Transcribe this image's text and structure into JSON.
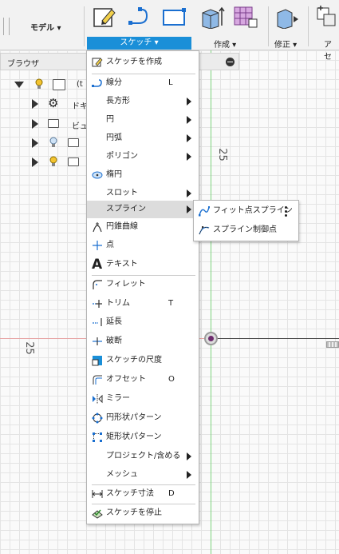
{
  "toolbar": {
    "model_label": "モデル ▾",
    "sketch_tab_label": "スケッチ ▾",
    "create_label": "作成 ▾",
    "modify_label": "修正 ▾",
    "assemble_label": "アセ"
  },
  "browser": {
    "title": "ブラウザ",
    "rows": [
      {
        "label": "(t"
      },
      {
        "label": "ドキ"
      },
      {
        "label": "ビュ"
      }
    ]
  },
  "canvas": {
    "ruler_top": "25",
    "ruler_left": "25"
  },
  "menu": {
    "items": [
      {
        "label": "スケッチを作成",
        "icon": "create-sketch-icon"
      },
      {
        "label": "線分",
        "shortcut": "L",
        "icon": "line-icon"
      },
      {
        "label": "長方形",
        "icon": "none"
      },
      {
        "label": "円",
        "icon": "none"
      },
      {
        "label": "円弧",
        "icon": "none"
      },
      {
        "label": "ポリゴン",
        "icon": "none"
      },
      {
        "label": "楕円",
        "icon": "ellipse-icon"
      },
      {
        "label": "スロット",
        "icon": "none"
      },
      {
        "label": "スプライン",
        "icon": "none"
      },
      {
        "label": "円錐曲線",
        "icon": "conic-curve-icon"
      },
      {
        "label": "点",
        "icon": "point-icon"
      },
      {
        "label": "テキスト",
        "icon": "text-icon"
      },
      {
        "label": "フィレット",
        "icon": "fillet-icon"
      },
      {
        "label": "トリム",
        "shortcut": "T",
        "icon": "trim-icon"
      },
      {
        "label": "延長",
        "icon": "extend-icon"
      },
      {
        "label": "破断",
        "icon": "break-icon"
      },
      {
        "label": "スケッチの尺度",
        "icon": "sketch-scale-icon"
      },
      {
        "label": "オフセット",
        "shortcut": "O",
        "icon": "offset-icon"
      },
      {
        "label": "ミラー",
        "icon": "mirror-icon"
      },
      {
        "label": "円形状パターン",
        "icon": "circular-pattern-icon"
      },
      {
        "label": "矩形状パターン",
        "icon": "rectangular-pattern-icon"
      },
      {
        "label": "プロジェクト/含める",
        "icon": "none"
      },
      {
        "label": "メッシュ",
        "icon": "none"
      },
      {
        "label": "スケッチ寸法",
        "shortcut": "D",
        "icon": "sketch-dimension-icon"
      },
      {
        "label": "スケッチを停止",
        "icon": "stop-sketch-icon"
      }
    ]
  },
  "submenu": {
    "items": [
      {
        "label": "フィット点スプライン",
        "icon": "fit-point-spline-icon"
      },
      {
        "label": "スプライン制御点",
        "icon": "control-point-spline-icon"
      }
    ]
  },
  "colors": {
    "accent": "#1a8fd8",
    "highlight": "#dcdcdc",
    "y_axis": "#7ed37e",
    "x_axis": "#e7a3a3"
  }
}
